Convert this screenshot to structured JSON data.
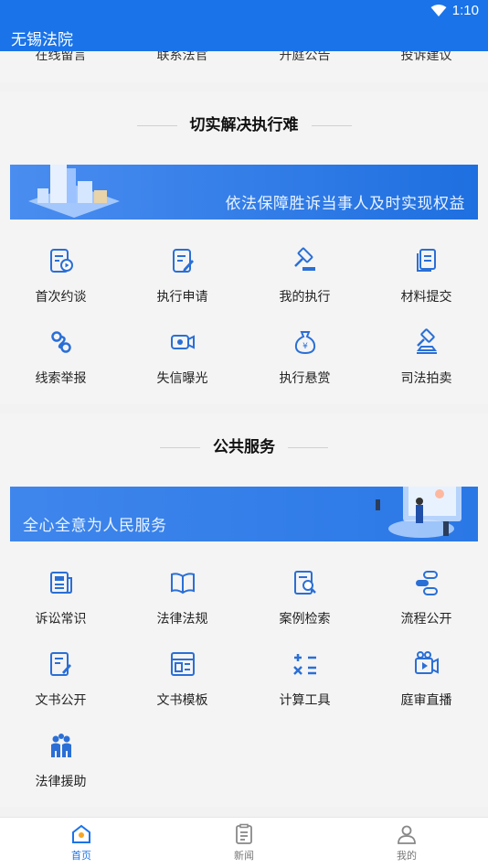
{
  "status": {
    "time": "1:10",
    "wifi_icon": "wifi-icon",
    "battery_icon": "battery-icon"
  },
  "app": {
    "title": "无锡法院"
  },
  "top_partial": {
    "items": [
      "在线留言",
      "联系法官",
      "开庭公告",
      "投诉建议"
    ]
  },
  "execution": {
    "title": "切实解决执行难",
    "banner_text": "依法保障胜诉当事人及时实现权益",
    "items": [
      {
        "label": "首次约谈",
        "icon": "interview-icon"
      },
      {
        "label": "执行申请",
        "icon": "apply-icon"
      },
      {
        "label": "我的执行",
        "icon": "gavel-icon"
      },
      {
        "label": "材料提交",
        "icon": "documents-icon"
      },
      {
        "label": "线索举报",
        "icon": "clue-icon"
      },
      {
        "label": "失信曝光",
        "icon": "camera-icon"
      },
      {
        "label": "执行悬赏",
        "icon": "money-bag-icon"
      },
      {
        "label": "司法拍卖",
        "icon": "auction-icon"
      }
    ]
  },
  "public": {
    "title": "公共服务",
    "banner_text": "全心全意为人民服务",
    "items": [
      {
        "label": "诉讼常识",
        "icon": "newspaper-icon"
      },
      {
        "label": "法律法规",
        "icon": "book-icon"
      },
      {
        "label": "案例检索",
        "icon": "search-doc-icon"
      },
      {
        "label": "流程公开",
        "icon": "flow-icon"
      },
      {
        "label": "文书公开",
        "icon": "doc-edit-icon"
      },
      {
        "label": "文书模板",
        "icon": "template-icon"
      },
      {
        "label": "计算工具",
        "icon": "calculator-icon"
      },
      {
        "label": "庭审直播",
        "icon": "live-icon"
      },
      {
        "label": "法律援助",
        "icon": "people-icon"
      }
    ]
  },
  "tabs": [
    {
      "label": "首页",
      "icon": "home-icon",
      "active": true
    },
    {
      "label": "新闻",
      "icon": "news-icon",
      "active": false
    },
    {
      "label": "我的",
      "icon": "user-icon",
      "active": false
    }
  ],
  "colors": {
    "primary": "#1a73e8",
    "icon_blue": "#2a6fd6"
  }
}
